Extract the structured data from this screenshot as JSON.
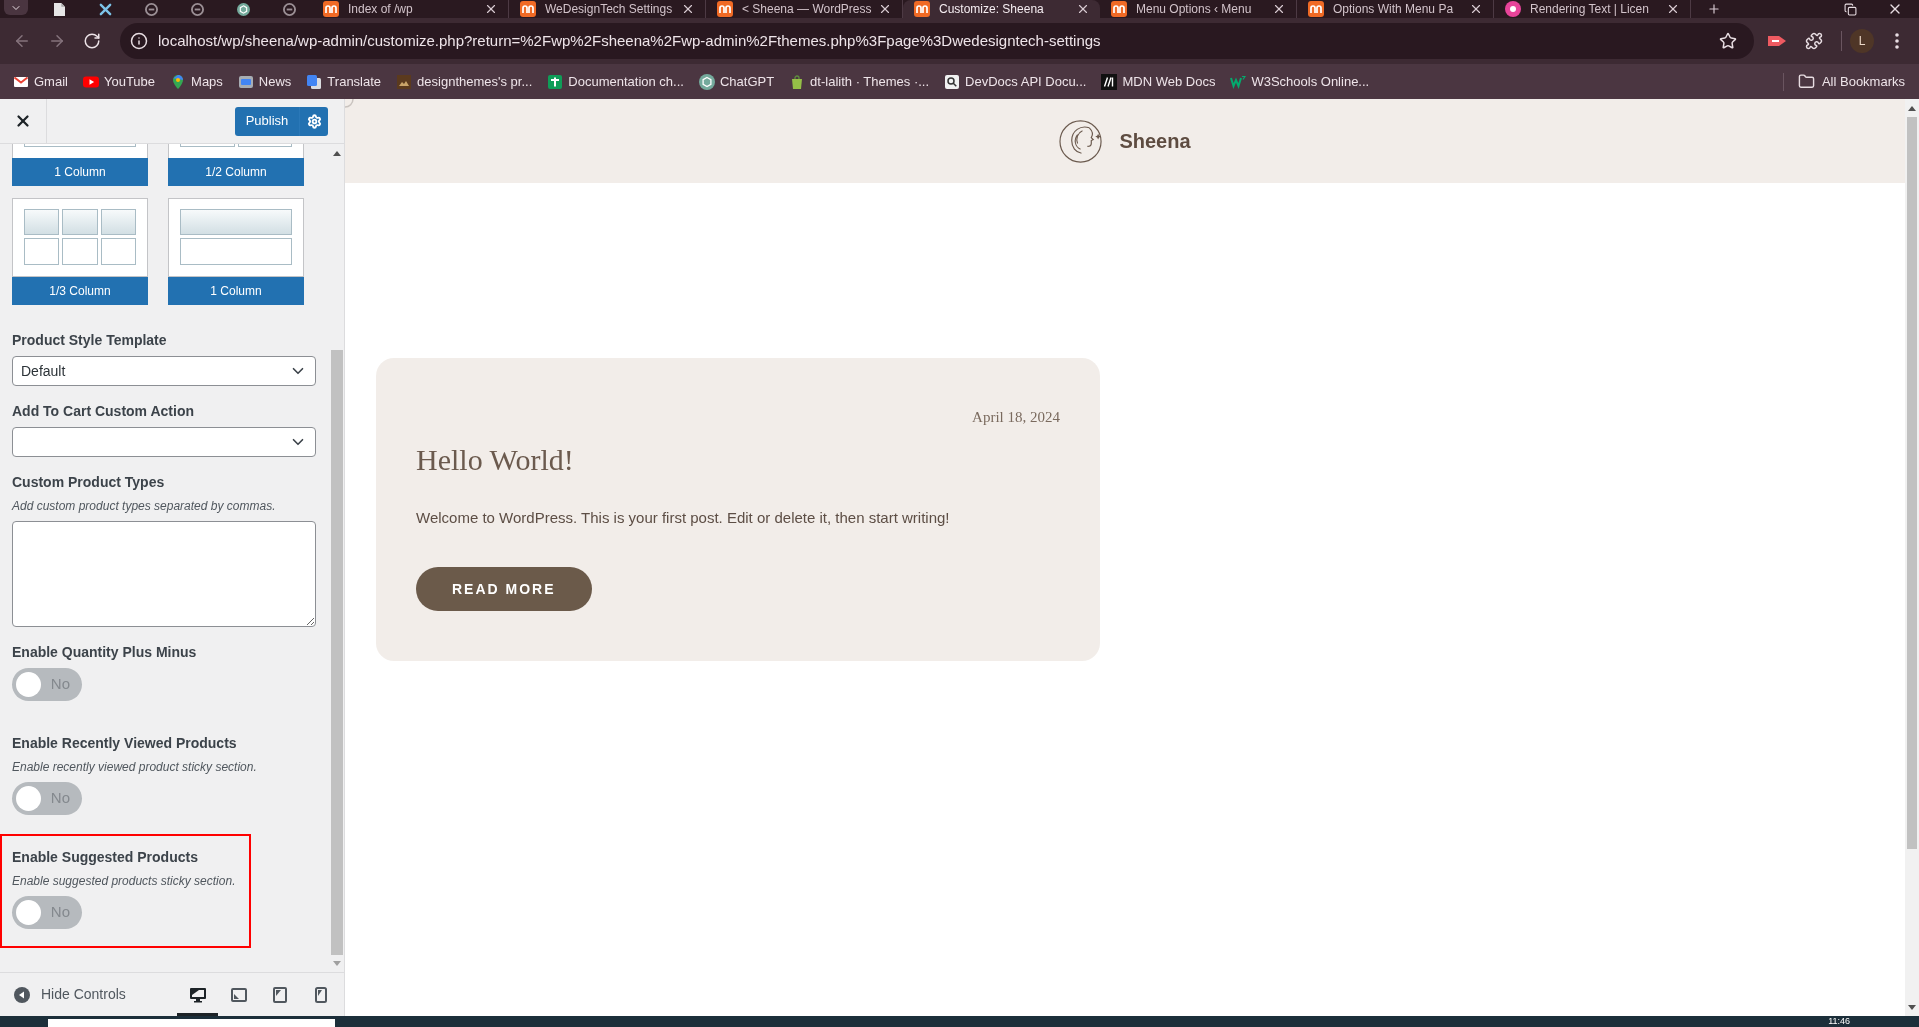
{
  "browser": {
    "tabs": [
      {
        "title": "Index of /wp",
        "selected": false
      },
      {
        "title": "WeDesignTech Settings",
        "selected": false
      },
      {
        "title": "< Sheena — WordPress",
        "selected": false
      },
      {
        "title": "Customize: Sheena",
        "selected": true
      },
      {
        "title": "Menu Options ‹ Menu",
        "selected": false
      },
      {
        "title": "Options With Menu Pa",
        "selected": false
      },
      {
        "title": "Rendering Text | Licen",
        "selected": false
      }
    ],
    "nav_buttons": [
      {
        "disabled": true
      },
      {
        "disabled": true
      },
      {
        "disabled": false
      }
    ],
    "address": "localhost/wp/sheena/wp-admin/customize.php?return=%2Fwp%2Fsheena%2Fwp-admin%2Fthemes.php%3Fpage%3Dwedesigntech-settings",
    "profile_initial": "L",
    "bookmarks": [
      "Gmail",
      "YouTube",
      "Maps",
      "News",
      "Translate",
      "designthemes's pr...",
      "Documentation ch...",
      "ChatGPT",
      "dt-lalith · Themes ·...",
      "DevDocs API Docu...",
      "MDN Web Docs",
      "W3Schools Online..."
    ],
    "all_bookmarks": "All Bookmarks"
  },
  "customizer": {
    "publish": "Publish",
    "layouts": [
      {
        "label": "1 Column",
        "kind": "single"
      },
      {
        "label": "1/2 Column",
        "kind": "half"
      },
      {
        "label": "1/3 Column",
        "kind": "third"
      },
      {
        "label": "1 Column",
        "kind": "single"
      }
    ],
    "settings": [
      {
        "kind": "select",
        "label": "Product Style Template",
        "value": "Default",
        "highlighted": false
      },
      {
        "kind": "select",
        "label": "Add To Cart Custom Action",
        "highlighted": false
      },
      {
        "kind": "textarea",
        "label": "Custom Product Types",
        "description": "Add custom product types separated by commas.",
        "highlighted": false
      },
      {
        "kind": "toggle",
        "label": "Enable Quantity Plus Minus",
        "on": false,
        "state_label": "No",
        "highlighted": false
      },
      {
        "kind": "toggle",
        "label": "Enable Recently Viewed Products",
        "description": "Enable recently viewed product sticky section.",
        "on": false,
        "state_label": "No",
        "highlighted": false
      },
      {
        "kind": "toggle",
        "label": "Enable Suggested Products",
        "description": "Enable suggested products sticky section.",
        "on": false,
        "state_label": "No",
        "highlighted": true
      }
    ],
    "hide_controls": "Hide Controls",
    "devices": [
      {
        "selected": true
      },
      {
        "selected": false
      },
      {
        "selected": false
      },
      {
        "selected": false
      }
    ]
  },
  "preview": {
    "site_title": "Sheena",
    "post": {
      "date": "April 18, 2024",
      "title": "Hello World!",
      "excerpt": "Welcome to WordPress. This is your first post. Edit or delete it, then start writing!",
      "button": "READ MORE"
    }
  },
  "taskbar": {
    "time": "11:46"
  }
}
